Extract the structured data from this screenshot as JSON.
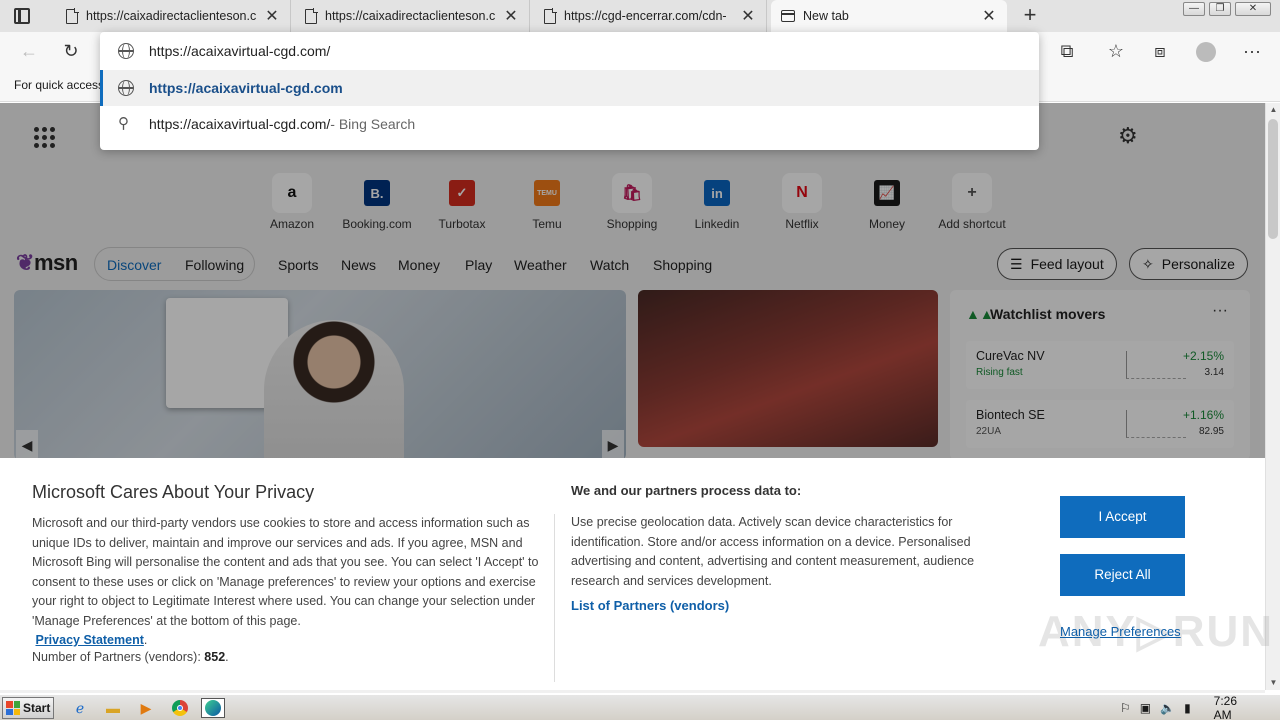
{
  "browser": {
    "tabs": [
      {
        "title": "https://caixadirectaclienteson.c",
        "icon": "document-icon"
      },
      {
        "title": "https://caixadirectaclienteson.c",
        "icon": "document-icon"
      },
      {
        "title": "https://cgd-encerrar.com/cdn-",
        "icon": "document-icon"
      },
      {
        "title": "New tab",
        "icon": "new-tab-icon",
        "active": true
      }
    ],
    "new_tab_label": "+",
    "close_glyph": "✕",
    "window_controls": [
      "—",
      "❐",
      "✕"
    ],
    "favorites_hint": "For quick access"
  },
  "omnibox": {
    "input_value": "https://acaixavirtual-cgd.com/",
    "suggestion_url": "https://acaixavirtual-cgd.com",
    "search_query": "https://acaixavirtual-cgd.com/",
    "search_suffix": " - Bing Search",
    "accent": "#0f6cbd"
  },
  "shortcuts": [
    {
      "label": "Amazon",
      "glyph": "a",
      "color": "#111"
    },
    {
      "label": "Booking.com",
      "glyph": "B.",
      "color": "#ffffff",
      "bg": "#003580"
    },
    {
      "label": "Turbotax",
      "glyph": "✓",
      "color": "#ffffff",
      "bg": "#d52b1e"
    },
    {
      "label": "Temu",
      "glyph": "TEMU",
      "color": "#ffffff",
      "bg": "#f27a1a"
    },
    {
      "label": "Shopping",
      "glyph": "🛍",
      "color": "#c2185b"
    },
    {
      "label": "Linkedin",
      "glyph": "in",
      "color": "#ffffff",
      "bg": "#0a66c2"
    },
    {
      "label": "Netflix",
      "glyph": "N",
      "color": "#e50914"
    },
    {
      "label": "Money",
      "glyph": "📈",
      "color": "#ffffff",
      "bg": "#1b1b1b"
    },
    {
      "label": "Add shortcut",
      "glyph": "+",
      "color": "#555"
    }
  ],
  "msn": {
    "logo": "msn",
    "tabs": [
      "Discover",
      "Following"
    ],
    "nav": [
      "Sports",
      "News",
      "Money",
      "Play",
      "Weather",
      "Watch",
      "Shopping"
    ],
    "feed_layout": "Feed layout",
    "personalize": "Personalize"
  },
  "watchlist": {
    "title": "Watchlist movers",
    "more": "···",
    "items": [
      {
        "name": "CureVac NV",
        "sub": "Rising fast",
        "pct": "+2.15%",
        "price": "3.14"
      },
      {
        "name": "Biontech SE",
        "sub": "22UA",
        "pct": "+1.16%",
        "price": "82.95"
      }
    ]
  },
  "privacy": {
    "title": "Microsoft Cares About Your Privacy",
    "body": "Microsoft and our third-party vendors use cookies to store and access information such as unique IDs to deliver, maintain and improve our services and ads. If you agree, MSN and Microsoft Bing will personalise the content and ads that you see. You can select 'I Accept' to consent to these uses or click on 'Manage preferences' to review your options and exercise your right to object to Legitimate Interest where used.  You can change your selection under 'Manage Preferences' at the bottom of this page.",
    "privacy_link": "Privacy Statement",
    "partners_count_label": "Number of Partners (vendors): ",
    "partners_count": "852",
    "purposes_title": "We and our partners process data to:",
    "purposes": "Use precise geolocation data. Actively scan device characteristics for identification. Store and/or access information on a device. Personalised advertising and content, advertising and content measurement, audience research and services development.",
    "partners_link": "List of Partners (vendors)",
    "accept": "I Accept",
    "reject": "Reject All",
    "manage": "Manage Preferences"
  },
  "taskbar": {
    "start": "Start",
    "clock": "7:26 AM"
  }
}
